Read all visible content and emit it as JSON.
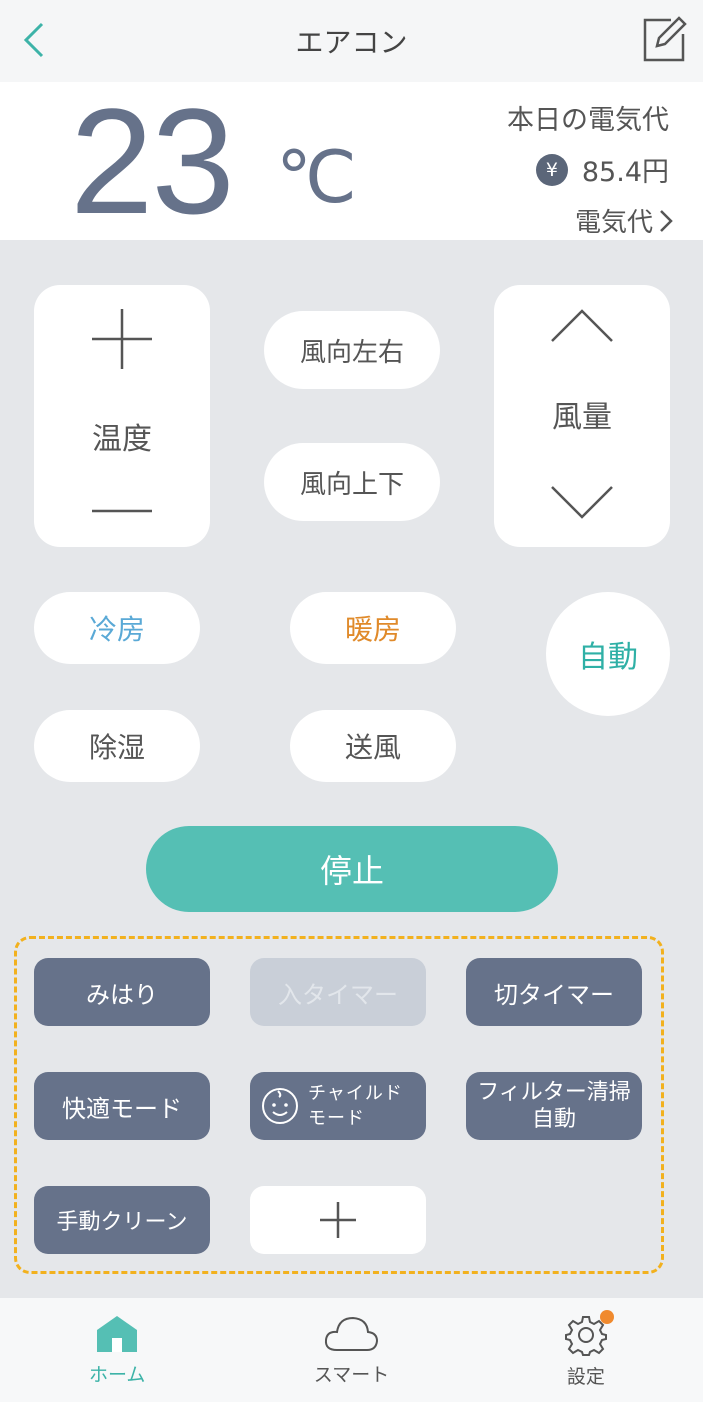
{
  "header": {
    "title": "エアコン"
  },
  "status": {
    "temperature": "23",
    "unit": "℃",
    "cost_title": "本日の電気代",
    "yen_symbol": "¥",
    "cost_value": "85.4円",
    "cost_link": "電気代"
  },
  "controls": {
    "temp_label": "温度",
    "fan_label": "風量",
    "wind_lr": "風向左右",
    "wind_ud": "風向上下",
    "modes": {
      "cool": "冷房",
      "heat": "暖房",
      "auto": "自動",
      "dry": "除湿",
      "fan": "送風"
    },
    "stop": "停止"
  },
  "functions": {
    "watch": "みはり",
    "on_timer": "入タイマー",
    "off_timer": "切タイマー",
    "comfort": "快適モード",
    "child_line1": "チャイルド",
    "child_line2": "モード",
    "filter_line1": "フィルター清掃",
    "filter_line2": "自動",
    "manual_clean": "手動クリーン"
  },
  "nav": {
    "home": "ホーム",
    "smart": "スマート",
    "settings": "設定"
  },
  "colors": {
    "accent": "#55bfb4",
    "button": "#66728a",
    "cool": "#5aa9d6",
    "heat": "#e08a2a",
    "highlight": "#f2b11e",
    "badge": "#f08a2e"
  }
}
